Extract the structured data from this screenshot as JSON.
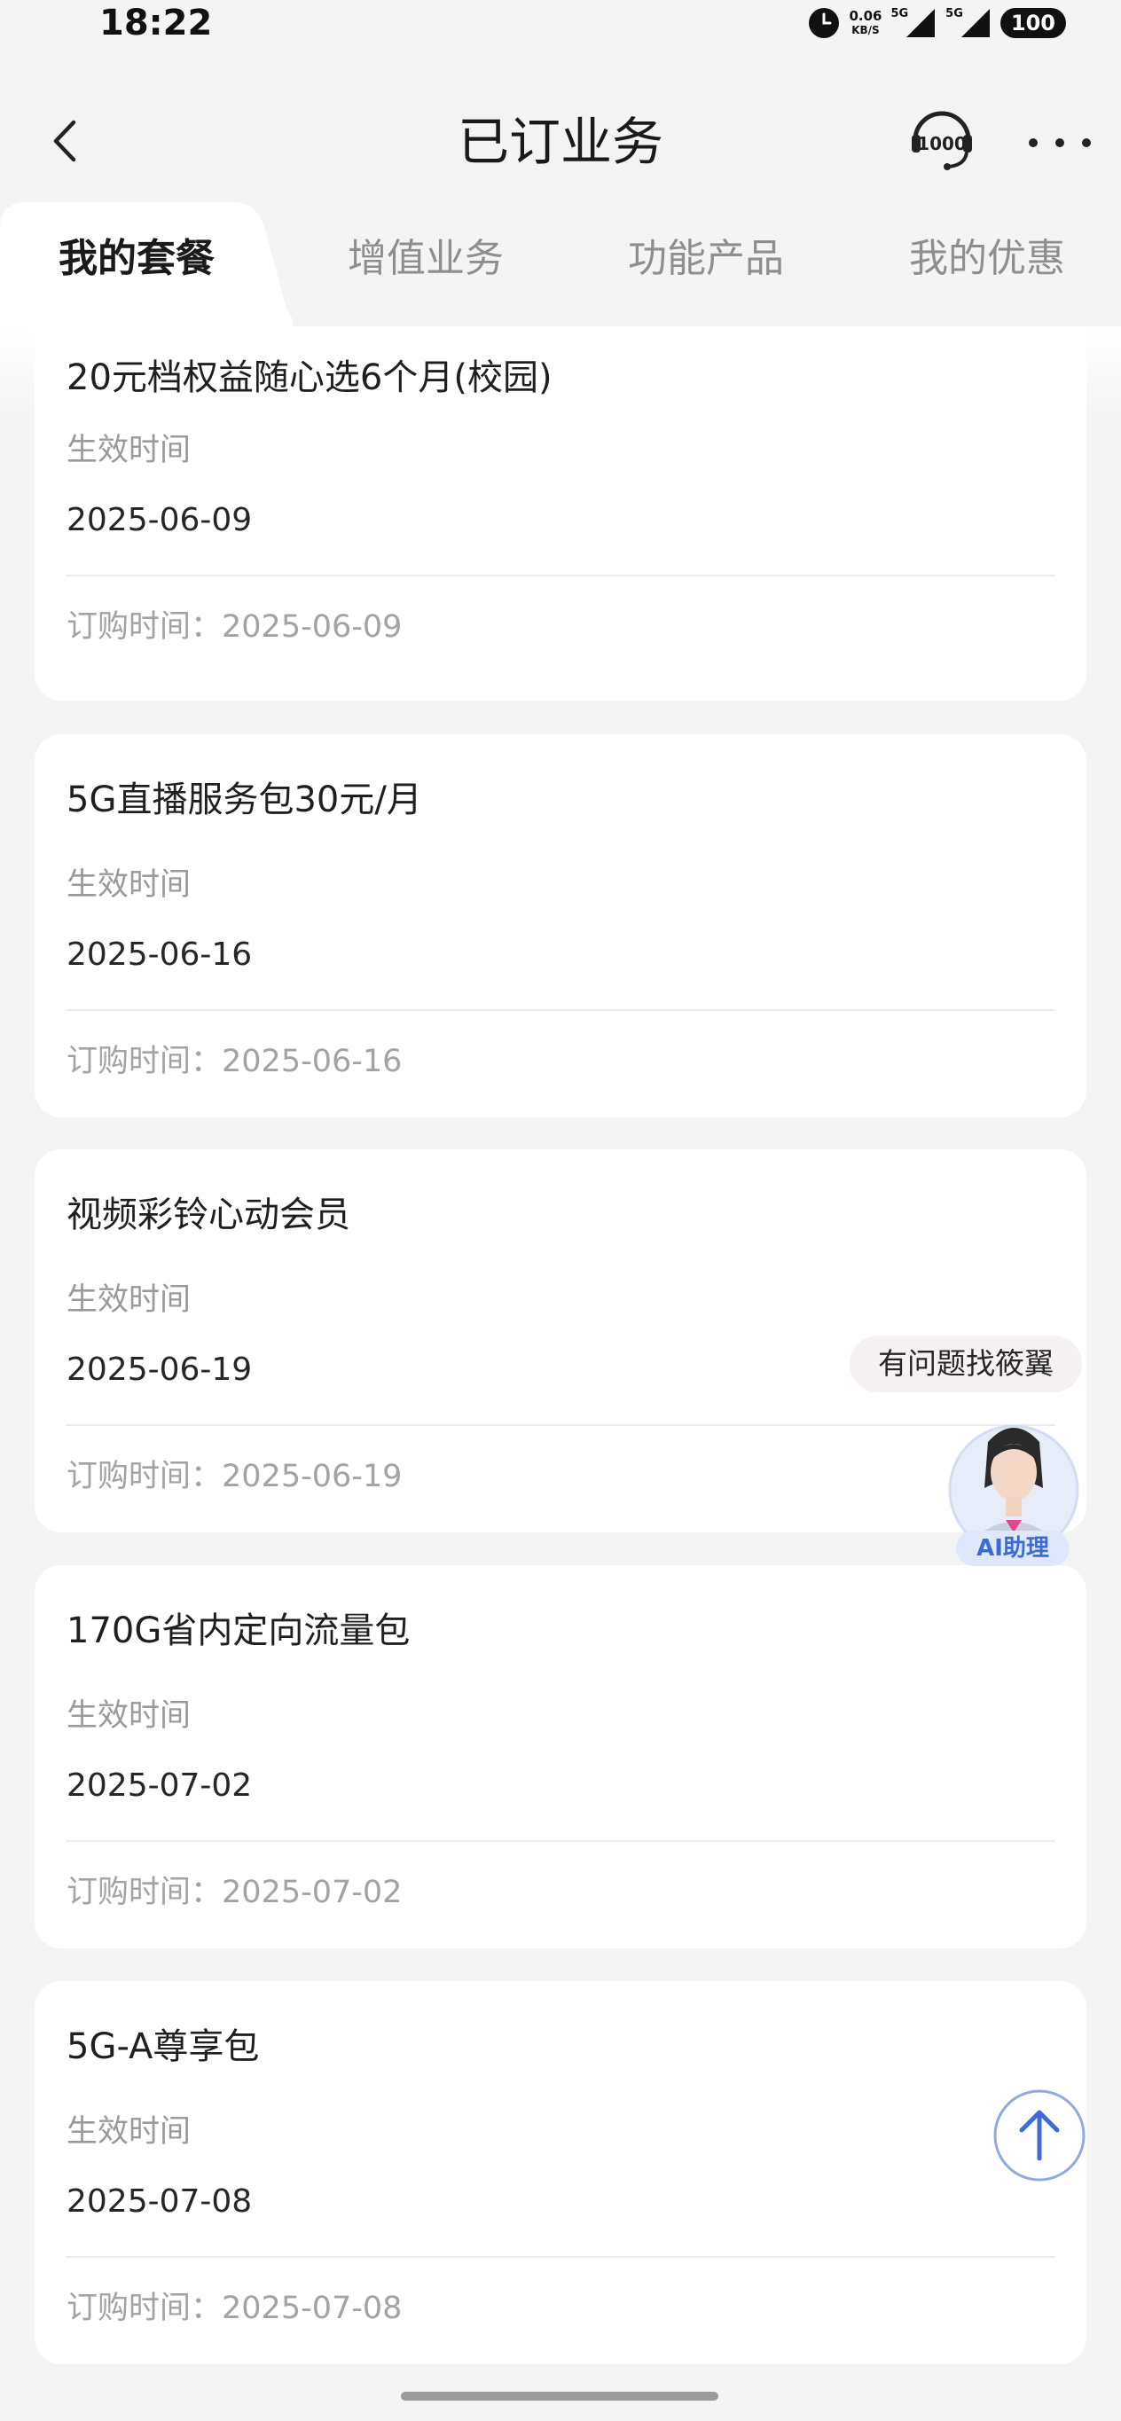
{
  "status_bar": {
    "time": "18:22",
    "speed_value": "0.06",
    "speed_unit": "KB/S",
    "signal1_label": "5G",
    "signal2_label": "5G",
    "battery": "100"
  },
  "header": {
    "title": "已订业务"
  },
  "tabs": [
    {
      "label": "我的套餐",
      "active": true
    },
    {
      "label": "增值业务",
      "active": false
    },
    {
      "label": "功能产品",
      "active": false
    },
    {
      "label": "我的优惠",
      "active": false
    }
  ],
  "labels": {
    "effective_time": "生效时间",
    "order_time_prefix": "订购时间："
  },
  "cards": [
    {
      "title": "20元档权益随心选6个月(校园)",
      "effective_date": "2025-06-09",
      "order_date": "2025-06-09"
    },
    {
      "title": "5G直播服务包30元/月",
      "effective_date": "2025-06-16",
      "order_date": "2025-06-16"
    },
    {
      "title": "视频彩铃心动会员",
      "effective_date": "2025-06-19",
      "order_date": "2025-06-19"
    },
    {
      "title": "170G省内定向流量包",
      "effective_date": "2025-07-02",
      "order_date": "2025-07-02"
    },
    {
      "title": "5G-A尊享包",
      "effective_date": "2025-07-08",
      "order_date": "2025-07-08"
    }
  ],
  "assistant": {
    "bubble": "有问题找筱翼",
    "label": "AI助理"
  },
  "colors": {
    "background": "#f4f4f4",
    "card": "#ffffff",
    "accent_blue": "#3c6bd8"
  }
}
